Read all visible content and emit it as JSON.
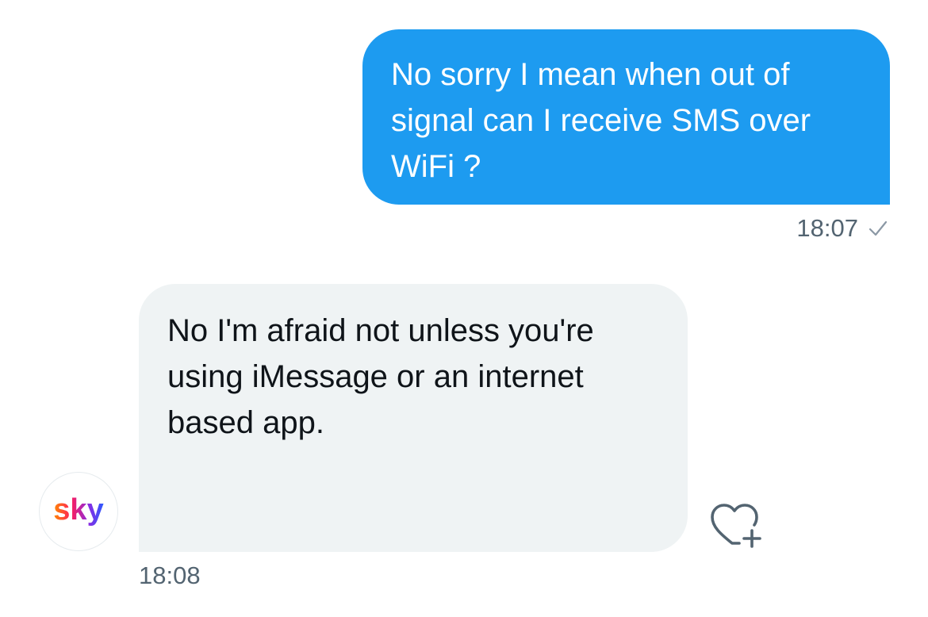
{
  "sent_message": {
    "text": "No sorry I mean when out of\nsignal can I receive SMS over\nWiFi ?",
    "time": "18:07",
    "status_icon": "check-icon"
  },
  "received_message": {
    "text": "No I'm afraid not unless you're\nusing iMessage or an internet\nbased app.",
    "time": "18:08",
    "sender_avatar": {
      "logo_text": "sky",
      "gradient_colors": [
        "#ff8a00",
        "#ff1e5a",
        "#8b2be2",
        "#2a5bff"
      ]
    },
    "like_icon": "heart-plus-icon"
  },
  "colors": {
    "sent_bubble": "#1d9bf0",
    "received_bubble": "#eff3f4",
    "timestamp": "#536471",
    "text_dark": "#0f1419"
  }
}
